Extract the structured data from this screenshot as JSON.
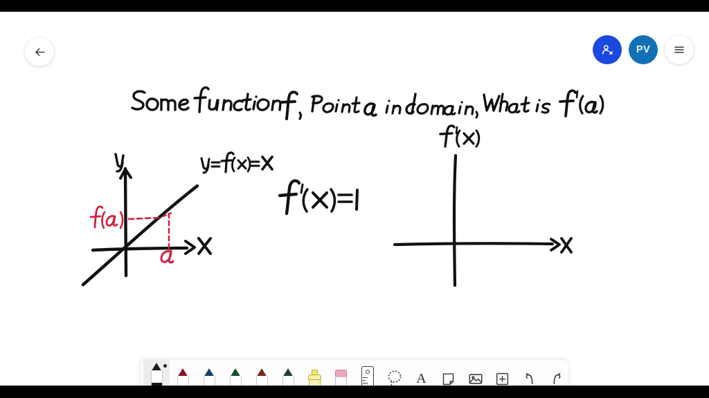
{
  "app": {
    "canvas_background": "#ffffff",
    "letterbox_color": "#000000",
    "ink_color": "#111111",
    "accent_red": "#d32040",
    "accent_blue": "#1a49e0",
    "avatar_color": "#1271b5"
  },
  "header": {
    "back_label": "Back",
    "back_icon": "arrow-left-icon",
    "add_person_icon": "add-person-icon",
    "avatar_initials": "PV",
    "menu_icon": "hamburger-menu-icon"
  },
  "notes": {
    "title_line": "Some function f, Point a in domain, What is f'(a)",
    "left_graph": {
      "curve_label": "y = f(x) = X",
      "y_axis_label": "y",
      "x_axis_label": "X",
      "value_label": "f(a)",
      "point_label": "a"
    },
    "center_equation": "f'(x) = 1",
    "right_graph": {
      "y_axis_label": "f'(x)",
      "x_axis_label": "X"
    }
  },
  "toolbar": {
    "tools": [
      {
        "name": "pen-black",
        "label": "Black pen",
        "color": "#151515",
        "selected": true
      },
      {
        "name": "pen-red",
        "label": "Red pen",
        "color": "#d01f36",
        "selected": false
      },
      {
        "name": "pen-blue",
        "label": "Blue pen",
        "color": "#1767c0",
        "selected": false
      },
      {
        "name": "pen-green",
        "label": "Green pen",
        "color": "#1c8a4e",
        "selected": false
      },
      {
        "name": "pen-multi-warm",
        "label": "Multicolor pen",
        "color": "#d0562a",
        "selected": false
      },
      {
        "name": "pen-multi-cool",
        "label": "Multicolor pen",
        "color": "#4a4f9e",
        "selected": false
      },
      {
        "name": "highlighter",
        "label": "Highlighter",
        "color": "#f2e96b",
        "selected": false
      },
      {
        "name": "eraser",
        "label": "Eraser",
        "color": "#eda7bf",
        "selected": false
      },
      {
        "name": "ruler",
        "label": "Ruler",
        "color": "#3d3d3d",
        "selected": false
      },
      {
        "name": "lasso-select",
        "label": "Lasso select",
        "color": "#3d3d3d",
        "selected": false
      },
      {
        "name": "text",
        "label": "Text",
        "color": "#2b2b2b",
        "selected": false
      },
      {
        "name": "sticky-note",
        "label": "Sticky note",
        "color": "#3d3d3d",
        "selected": false
      },
      {
        "name": "image",
        "label": "Insert image",
        "color": "#3d3d3d",
        "selected": false
      },
      {
        "name": "add-page",
        "label": "Add",
        "color": "#3d3d3d",
        "selected": false
      },
      {
        "name": "undo",
        "label": "Undo",
        "color": "#3d3d3d",
        "selected": false
      },
      {
        "name": "redo",
        "label": "Redo",
        "color": "#3d3d3d",
        "selected": false
      }
    ]
  }
}
